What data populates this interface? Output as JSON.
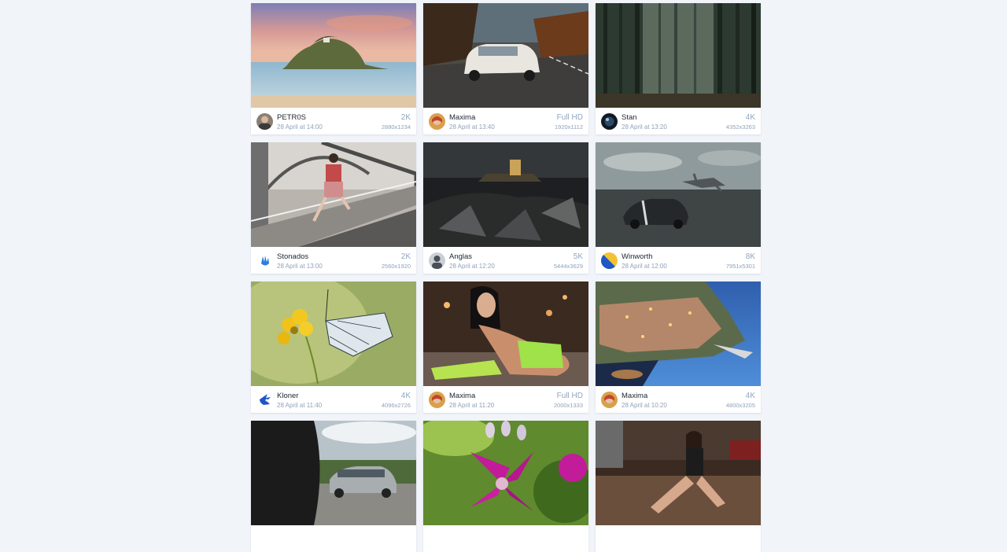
{
  "gallery": {
    "cards": [
      {
        "scene": "island-sea",
        "avatar": "avatar-man",
        "author": "PETR0S",
        "date": "28 April at 14:00",
        "resolution": "2K",
        "dimensions": "2880x1234"
      },
      {
        "scene": "white-car-road",
        "avatar": "avatar-redhead",
        "author": "Maxima",
        "date": "28 April at 13:40",
        "resolution": "Full HD",
        "dimensions": "1920x1112"
      },
      {
        "scene": "dark-forest",
        "avatar": "avatar-dark-orb",
        "author": "Stan",
        "date": "28 April at 13:20",
        "resolution": "4K",
        "dimensions": "4352x3263"
      },
      {
        "scene": "girl-on-bridge",
        "avatar": "avatar-blue-hand",
        "author": "Stonados",
        "date": "28 April at 13:00",
        "resolution": "2K",
        "dimensions": "2560x1920"
      },
      {
        "scene": "castle-night-shore",
        "avatar": "avatar-gray-person",
        "author": "Anglas",
        "date": "28 April at 12:20",
        "resolution": "5K",
        "dimensions": "5444x3629"
      },
      {
        "scene": "supercar-and-jet",
        "avatar": "avatar-blue-yellow",
        "author": "Winworth",
        "date": "28 April at 12:00",
        "resolution": "8K",
        "dimensions": "7951x5301"
      },
      {
        "scene": "butterfly-yellow-flower",
        "avatar": "avatar-blue-hedgehog",
        "author": "Kloner",
        "date": "28 April at 11:40",
        "resolution": "4K",
        "dimensions": "4096x2726"
      },
      {
        "scene": "woman-green-top",
        "avatar": "avatar-redhead",
        "author": "Maxima",
        "date": "28 April at 11:20",
        "resolution": "Full HD",
        "dimensions": "2000x1333"
      },
      {
        "scene": "coastal-village-night",
        "avatar": "avatar-redhead",
        "author": "Maxima",
        "date": "28 April at 10:20",
        "resolution": "4K",
        "dimensions": "4800x3205"
      },
      {
        "scene": "silver-car-tree",
        "avatar": "",
        "author": "",
        "date": "",
        "resolution": "",
        "dimensions": ""
      },
      {
        "scene": "pink-flower",
        "avatar": "",
        "author": "",
        "date": "",
        "resolution": "",
        "dimensions": ""
      },
      {
        "scene": "woman-dark-room",
        "avatar": "",
        "author": "",
        "date": "",
        "resolution": "",
        "dimensions": ""
      }
    ]
  }
}
